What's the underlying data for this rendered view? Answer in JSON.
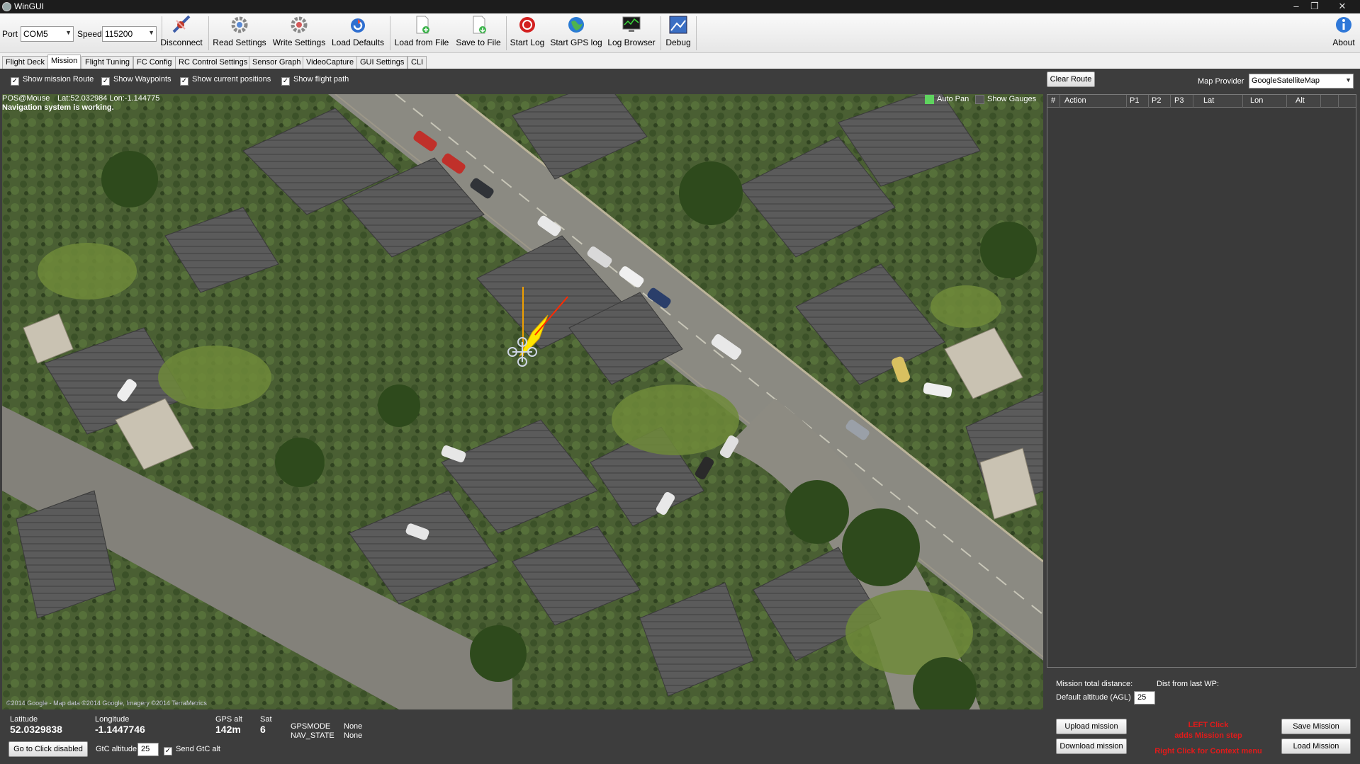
{
  "window": {
    "title": "WinGUI",
    "minimize": "–",
    "restore": "❐",
    "close": "✕"
  },
  "toolbar": {
    "port_label": "Port",
    "port_value": "COM5",
    "speed_label": "Speed",
    "speed_value": "115200",
    "buttons": {
      "disconnect": "Disconnect",
      "read_settings": "Read Settings",
      "write_settings": "Write Settings",
      "load_defaults": "Load Defaults",
      "load_from_file": "Load from File",
      "save_to_file": "Save to File",
      "start_log": "Start Log",
      "start_gps_log": "Start GPS log",
      "log_browser": "Log Browser",
      "debug": "Debug",
      "about": "About"
    }
  },
  "tabs": [
    "Flight Deck",
    "Mission",
    "Flight Tuning",
    "FC Config",
    "RC Control Settings",
    "Sensor Graph",
    "VideoCapture",
    "GUI Settings",
    "CLI"
  ],
  "active_tab": "Mission",
  "options": {
    "show_mission_route": "Show mission Route",
    "show_waypoints": "Show Waypoints",
    "show_current_positions": "Show current positions",
    "show_flight_path": "Show flight path",
    "check_mark": "✓"
  },
  "map": {
    "pos_at_mouse": "POS@Mouse",
    "mouse_coords": "Lat:52.032984 Lon:-1.144775",
    "nav_status": "Navigation system is working.",
    "auto_pan": "Auto Pan",
    "show_gauges": "Show Gauges",
    "copyright": "©2014 Google - Map data ©2014 Google, Imagery ©2014 TerraMetrics",
    "colors": {
      "auto_pan": "#5fd35f",
      "heading_line": "#ff2a00",
      "track_line": "#f0a000",
      "path_fill": "#ffe600"
    }
  },
  "mission": {
    "clear_route": "Clear Route",
    "map_provider_label": "Map Provider",
    "map_provider_value": "GoogleSatelliteMap",
    "columns": [
      "#",
      "Action",
      "P1",
      "P2",
      "P3",
      "Lat",
      "Lon",
      "Alt"
    ],
    "total_distance_label": "Mission total distance:",
    "dist_from_last_label": "Dist from last WP:",
    "default_alt_label": "Default altitude (AGL)",
    "default_alt_value": "25",
    "upload": "Upload mission",
    "download": "Download mission",
    "save": "Save Mission",
    "load": "Load Mission",
    "hint_line1": "LEFT Click",
    "hint_line2": "adds Mission step",
    "hint_line3": "Right Click for Context menu",
    "hint_color": "#e21a1a"
  },
  "status": {
    "latitude_label": "Latitude",
    "latitude_value": "52.0329838",
    "longitude_label": "Longitude",
    "longitude_value": "-1.1447746",
    "gps_alt_label": "GPS alt",
    "gps_alt_value": "142m",
    "sat_label": "Sat",
    "sat_value": "6",
    "gpsmode_label": "GPSMODE",
    "gpsmode_value": "None",
    "navstate_label": "NAV_STATE",
    "navstate_value": "None",
    "goto_click": "Go to Click disabled",
    "gtc_alt_label": "GtC altitude:",
    "gtc_alt_value": "25",
    "send_gtc_alt": "Send GtC alt"
  }
}
